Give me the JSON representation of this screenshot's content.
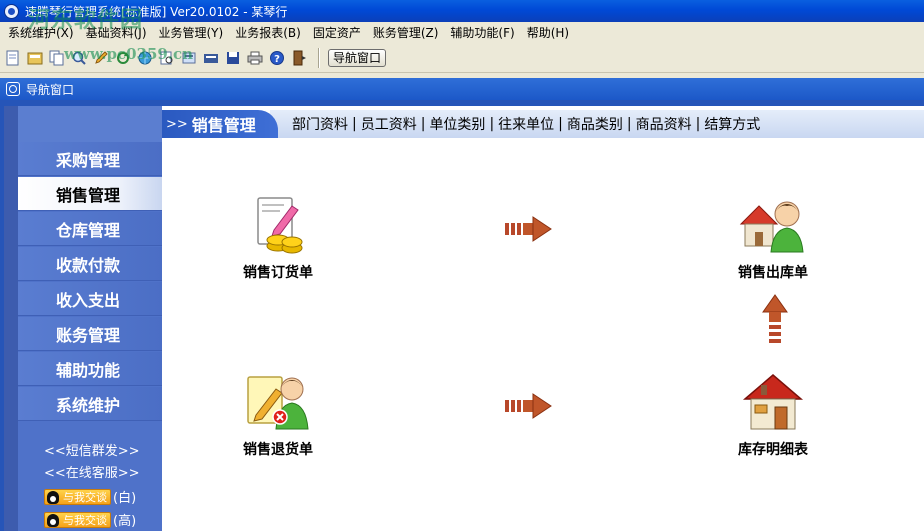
{
  "window": {
    "title": "速腾琴行管理系统[标准版] Ver20.0102  -  某琴行"
  },
  "watermark": {
    "text": "河东软件园",
    "url": "www.pc0359.cn"
  },
  "menubar": {
    "items": [
      {
        "label": "系统维护(X)"
      },
      {
        "label": "基础资料(J)"
      },
      {
        "label": "业务管理(Y)"
      },
      {
        "label": "业务报表(B)"
      },
      {
        "label": "固定资产"
      },
      {
        "label": "账务管理(Z)"
      },
      {
        "label": "辅助功能(F)"
      },
      {
        "label": "帮助(H)"
      }
    ]
  },
  "toolbar": {
    "icons": [
      "new-doc-icon",
      "open-icon",
      "copy-icon",
      "search-icon",
      "edit-icon",
      "refresh-icon",
      "network-icon",
      "print-preview-icon",
      "export-icon",
      "card-icon",
      "save-icon",
      "print-icon",
      "help-icon",
      "exit-icon"
    ],
    "nav_window_label": "导航窗口"
  },
  "inner_window": {
    "title": "导航窗口"
  },
  "sidebar": {
    "items": [
      {
        "label": "采购管理",
        "active": false
      },
      {
        "label": "销售管理",
        "active": true
      },
      {
        "label": "仓库管理",
        "active": false
      },
      {
        "label": "收款付款",
        "active": false
      },
      {
        "label": "收入支出",
        "active": false
      },
      {
        "label": "账务管理",
        "active": false
      },
      {
        "label": "辅助功能",
        "active": false
      },
      {
        "label": "系统维护",
        "active": false
      }
    ],
    "sms_link": "<<短信群发>>",
    "service_link": "<<在线客服>>",
    "qq": [
      {
        "badge": "与我交谈",
        "suffix": "(白)"
      },
      {
        "badge": "与我交谈",
        "suffix": "(高)"
      }
    ]
  },
  "main": {
    "tab_chevron": ">>",
    "tab_title": "销售管理",
    "tab_links": [
      "部门资料",
      "员工资料",
      "单位类别",
      "往来单位",
      "商品类别",
      "商品资料",
      "结算方式"
    ],
    "tab_separator": "|",
    "functions": {
      "sales_order": {
        "label": "销售订货单",
        "icon": "sales-order-icon"
      },
      "sales_outbound": {
        "label": "销售出库单",
        "icon": "sales-outbound-icon"
      },
      "sales_return": {
        "label": "销售退货单",
        "icon": "sales-return-icon"
      },
      "inventory_detail": {
        "label": "库存明细表",
        "icon": "inventory-house-icon"
      }
    }
  },
  "colors": {
    "titlebar": "#0049d6",
    "sidebar": "#4f72c9",
    "tab_accent": "#2a59c0",
    "arrow": "#c0562a"
  }
}
